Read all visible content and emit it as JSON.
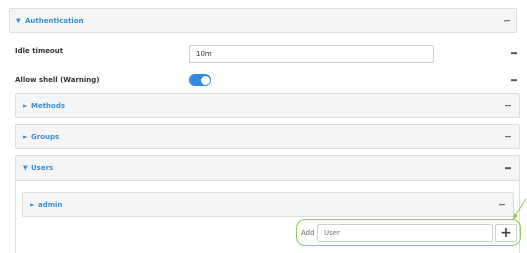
{
  "authentication": {
    "title": "Authentication",
    "idle_timeout": {
      "label": "Idle timeout",
      "value": "10m"
    },
    "allow_shell": {
      "label": "Allow shell (Warning)",
      "enabled": true
    },
    "methods": {
      "title": "Methods"
    },
    "groups": {
      "title": "Groups"
    },
    "users": {
      "title": "Users",
      "items": [
        {
          "title": "admin"
        }
      ],
      "add": {
        "label": "Add",
        "placeholder": "User",
        "button": "+"
      }
    }
  },
  "icons": {
    "expanded": "triangle-down-icon",
    "collapsed": "triangle-right-icon",
    "menu": "dash-icon",
    "add": "plus-icon"
  },
  "colors": {
    "accent": "#3a8fd0",
    "toggle_on": "#2f8ae0",
    "callout": "#92c95a",
    "header_bg": "#f4f5f7"
  }
}
